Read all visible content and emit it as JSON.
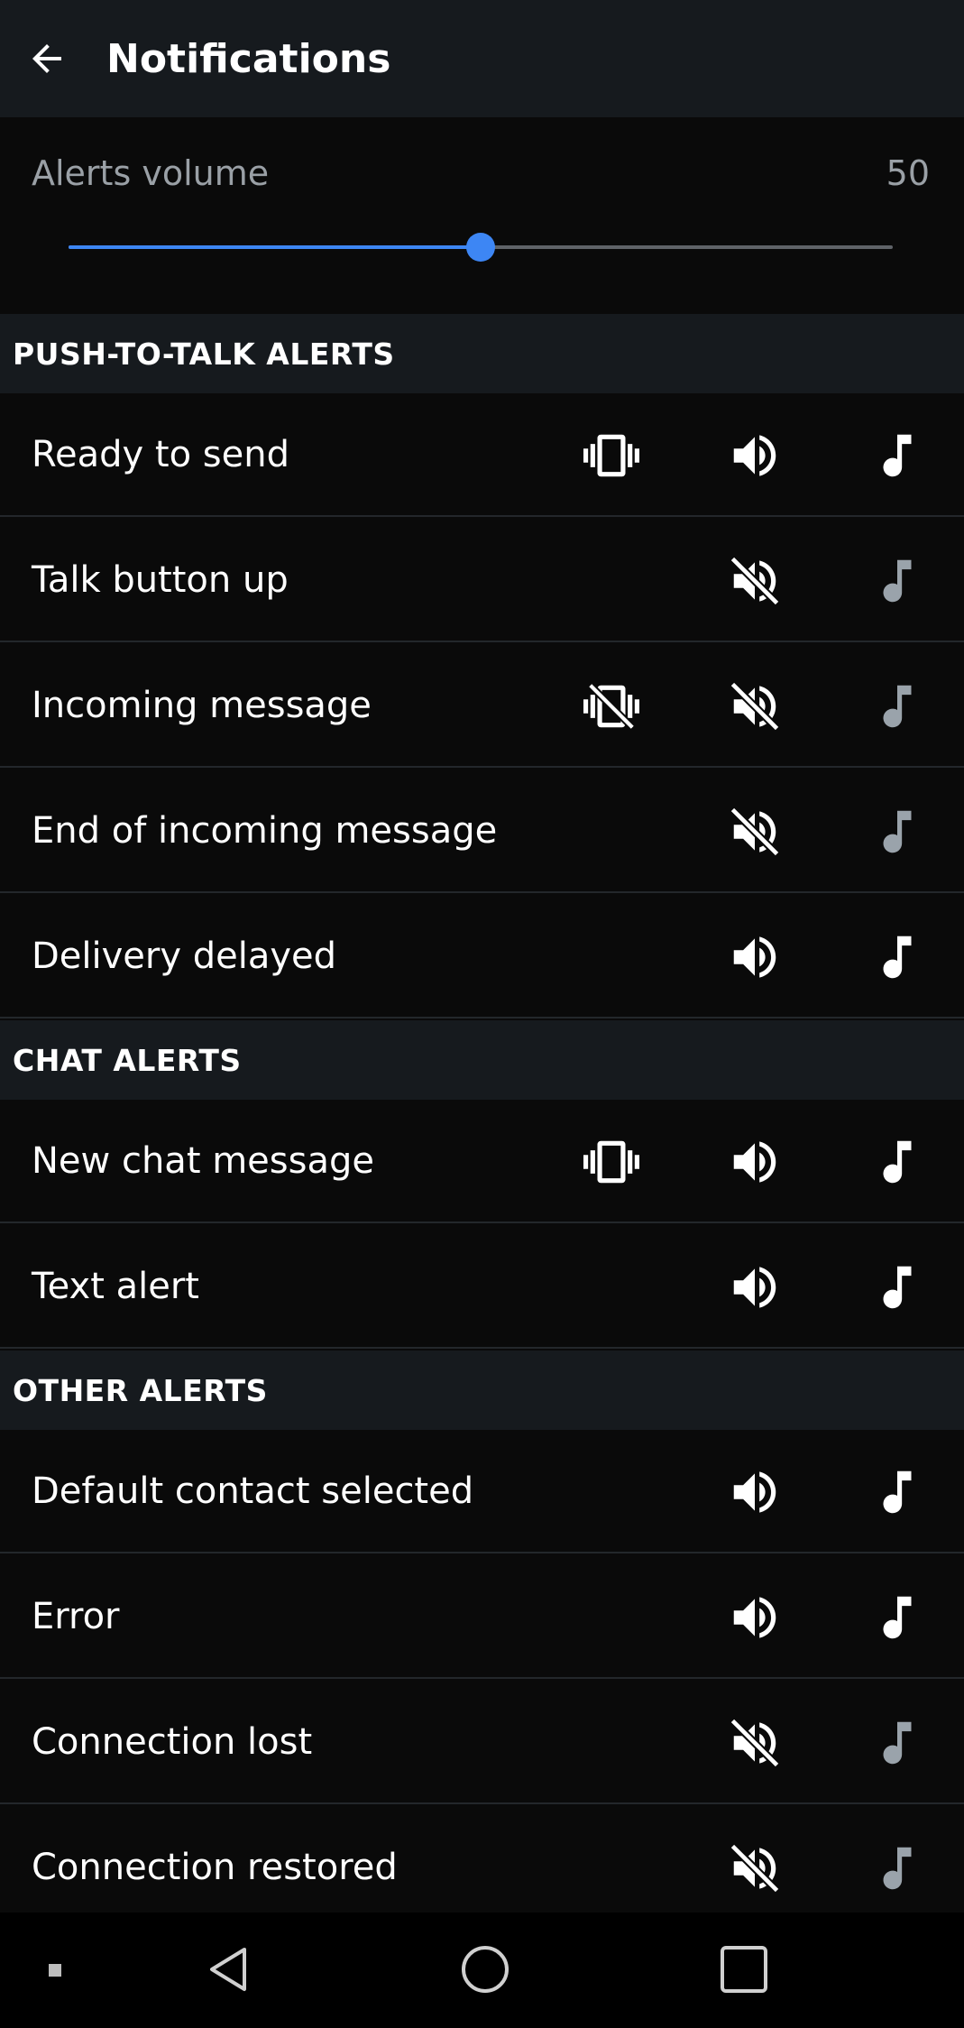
{
  "header": {
    "title": "Notifications"
  },
  "volume": {
    "label": "Alerts volume",
    "value": "50",
    "level_fraction": 0.5
  },
  "colors": {
    "accent": "#3d86f4",
    "icon_on": "#ffffff",
    "icon_off": "#9aa3ab"
  },
  "sections": [
    {
      "title": "PUSH-TO-TALK ALERTS",
      "items": [
        {
          "label": "Ready to send",
          "vibrate": "on",
          "sound": "on",
          "tone": "on"
        },
        {
          "label": "Talk button up",
          "vibrate": "none",
          "sound": "off",
          "tone": "off"
        },
        {
          "label": "Incoming message",
          "vibrate": "off",
          "sound": "off",
          "tone": "off"
        },
        {
          "label": "End of incoming message",
          "vibrate": "none",
          "sound": "off",
          "tone": "off"
        },
        {
          "label": "Delivery delayed",
          "vibrate": "none",
          "sound": "on",
          "tone": "on"
        }
      ]
    },
    {
      "title": "CHAT ALERTS",
      "items": [
        {
          "label": "New chat message",
          "vibrate": "on",
          "sound": "on",
          "tone": "on"
        },
        {
          "label": "Text alert",
          "vibrate": "none",
          "sound": "on",
          "tone": "on"
        }
      ]
    },
    {
      "title": "OTHER ALERTS",
      "items": [
        {
          "label": "Default contact selected",
          "vibrate": "none",
          "sound": "on",
          "tone": "on"
        },
        {
          "label": "Error",
          "vibrate": "none",
          "sound": "on",
          "tone": "on"
        },
        {
          "label": "Connection lost",
          "vibrate": "none",
          "sound": "off",
          "tone": "off"
        },
        {
          "label": "Connection restored",
          "vibrate": "none",
          "sound": "off",
          "tone": "off"
        }
      ]
    }
  ],
  "icons": {
    "back": "arrow-left-icon",
    "vibrate_on": "vibrate-icon",
    "vibrate_off": "vibrate-off-icon",
    "sound_on": "volume-up-icon",
    "sound_off": "volume-off-icon",
    "tone": "music-note-icon"
  }
}
